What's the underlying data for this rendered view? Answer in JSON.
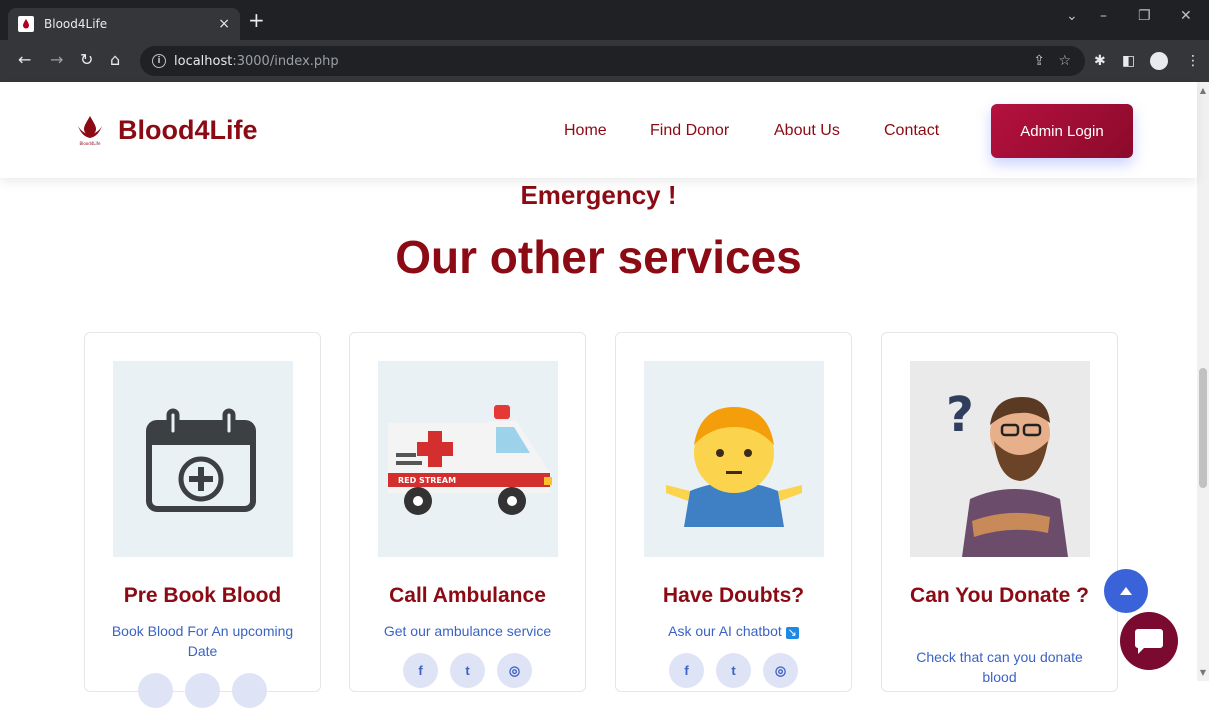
{
  "browser": {
    "tab_title": "Blood4Life",
    "tab_close": "×",
    "new_tab": "+",
    "url_host": "localhost",
    "url_rest": ":3000/index.php"
  },
  "header": {
    "brand_name": "Blood4Life",
    "logo_caption": "Blood4Life",
    "nav": [
      "Home",
      "Find Donor",
      "About Us",
      "Contact"
    ],
    "admin_label": "Admin Login"
  },
  "main": {
    "emergency_text": "Emergency !",
    "section_title": "Our other services",
    "cards": [
      {
        "title": "Pre Book Blood",
        "desc": "Book Blood For An upcoming Date",
        "icon": "calendar-plus-icon"
      },
      {
        "title": "Call Ambulance",
        "desc": "Get our ambulance service",
        "icon": "ambulance-icon",
        "ambulance_label": "RED STREAM"
      },
      {
        "title": "Have Doubts?",
        "desc": "Ask our AI chatbot",
        "icon": "shrugging-person-icon",
        "desc_suffix": "↘"
      },
      {
        "title": "Can You Donate ?",
        "desc": "Check that can you donate blood",
        "icon": "thinking-man-icon",
        "question_mark": "?"
      }
    ],
    "social_icons": [
      "facebook-icon",
      "twitter-icon",
      "instagram-icon"
    ],
    "social_glyphs": [
      "f",
      "t",
      "◎"
    ]
  },
  "colors": {
    "brand": "#8b0a14",
    "link_blue": "#3b63c4",
    "admin_gradient_start": "#b5113f",
    "admin_gradient_end": "#8b0a2a",
    "scroll_top_bg": "#3b63d9",
    "chat_bg": "#7a0a2f"
  }
}
